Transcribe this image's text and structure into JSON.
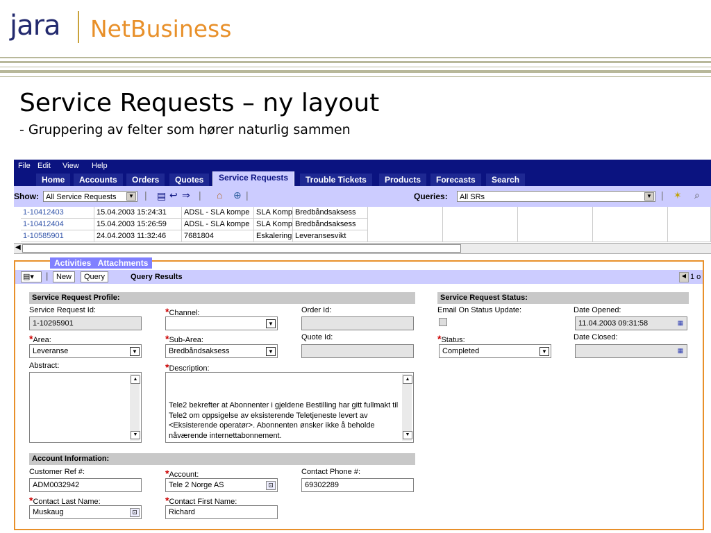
{
  "brand": {
    "jara": "jara",
    "netbusiness": "NetBusiness"
  },
  "slide": {
    "title": "Service Requests – ny layout",
    "subtitle": "- Gruppering av felter som hører naturlig sammen"
  },
  "menu": [
    "File",
    "Edit",
    "View",
    "Help"
  ],
  "tabs": [
    "Home",
    "Accounts",
    "Orders",
    "Quotes",
    "Service Requests",
    "Trouble Tickets",
    "Products",
    "Forecasts",
    "Search"
  ],
  "active_tab": "Service Requests",
  "showbar": {
    "show_label": "Show:",
    "show_value": "All Service Requests",
    "queries_label": "Queries:",
    "queries_value": "All SRs"
  },
  "list_rows": [
    {
      "id": "1-10412403",
      "date": "15.04.2003 15:24:31",
      "product": "ADSL - SLA kompe",
      "type": "SLA Komp",
      "area": "Bredbåndsaksess"
    },
    {
      "id": "1-10412404",
      "date": "15.04.2003 15:26:59",
      "product": "ADSL - SLA kompe",
      "type": "SLA Komp",
      "area": "Bredbåndsaksess"
    },
    {
      "id": "1-10585901",
      "date": "24.04.2003 11:32:46",
      "product": "7681804",
      "type": "Eskalering",
      "area": "Leveransesvikt"
    }
  ],
  "subtabs": {
    "activities": "Activities",
    "attachments": "Attachments"
  },
  "querybar": {
    "new": "New",
    "query": "Query",
    "results": "Query Results",
    "page": "1 o"
  },
  "profile": {
    "header": "Service Request Profile:",
    "sr_id_label": "Service Request Id:",
    "sr_id": "1-10295901",
    "channel_label": "Channel:",
    "channel": "",
    "order_id_label": "Order Id:",
    "order_id": "",
    "area_label": "Area:",
    "area": "Leveranse",
    "subarea_label": "Sub-Area:",
    "subarea": "Bredbåndsaksess",
    "quote_id_label": "Quote Id:",
    "quote_id": "",
    "abstract_label": "Abstract:",
    "abstract": "",
    "description_label": "Description:",
    "description": "Tele2 bekrefter at Abonnenter i gjeldene Bestilling har gitt fullmakt til Tele2 om oppsigelse av eksisterende Teletjeneste levert av <Eksisterende operatør>. Abonnenten ønsker ikke å beholde nåværende internettabonnement."
  },
  "status": {
    "header": "Service Request Status:",
    "email_label": "Email On Status Update:",
    "date_opened_label": "Date Opened:",
    "date_opened": "11.04.2003 09:31:58",
    "status_label": "Status:",
    "status": "Completed",
    "date_closed_label": "Date Closed:",
    "date_closed": ""
  },
  "account": {
    "header": "Account Information:",
    "cust_ref_label": "Customer Ref #:",
    "cust_ref": "ADM0032942",
    "account_label": "Account:",
    "account": "Tele 2 Norge AS",
    "phone_label": "Contact Phone #:",
    "phone": "69302289",
    "last_name_label": "Contact Last Name:",
    "last_name": "Muskaug",
    "first_name_label": "Contact First Name:",
    "first_name": "Richard"
  },
  "colors": {
    "navy": "#0b1380",
    "lavender": "#ccccff",
    "orange": "#e8902a",
    "required": "#cc0000"
  },
  "icons": [
    "dropdown-arrow-icon",
    "list-menu-icon",
    "home-icon",
    "globe-icon",
    "calendar-icon",
    "pick-icon",
    "scroll-up-icon",
    "scroll-down-icon",
    "search-icon"
  ]
}
